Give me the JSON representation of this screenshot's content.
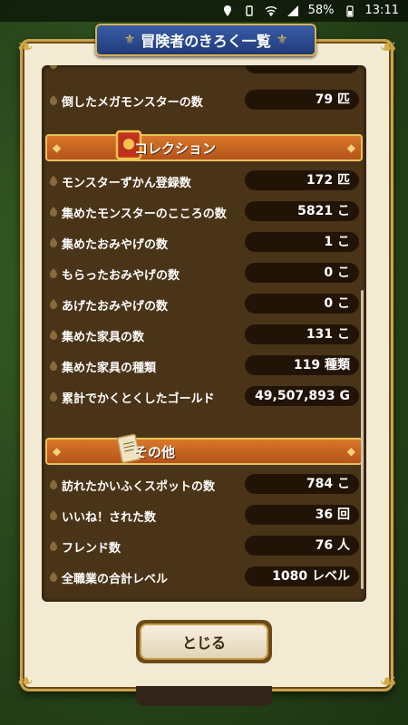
{
  "status_bar": {
    "battery": "58%",
    "time": "13:11"
  },
  "title": "冒険者のきろく一覧",
  "rows_top": [
    {
      "label": "倒したメガモンスターの数",
      "value": "79 匹"
    }
  ],
  "section_collection": {
    "label": "コレクション",
    "rows": [
      {
        "label": "モンスターずかん登録数",
        "value": "172 匹"
      },
      {
        "label": "集めたモンスターのこころの数",
        "value": "5821 こ"
      },
      {
        "label": "集めたおみやげの数",
        "value": "1 こ"
      },
      {
        "label": "もらったおみやげの数",
        "value": "0 こ"
      },
      {
        "label": "あげたおみやげの数",
        "value": "0 こ"
      },
      {
        "label": "集めた家具の数",
        "value": "131 こ"
      },
      {
        "label": "集めた家具の種類",
        "value": "119 種類"
      },
      {
        "label": "累計でかくとくしたゴールド",
        "value": "49,507,893 G"
      }
    ]
  },
  "section_other": {
    "label": "その他",
    "rows": [
      {
        "label": "訪れたかいふくスポットの数",
        "value": "784 こ"
      },
      {
        "label": "いいね！された数",
        "value": "36 回"
      },
      {
        "label": "フレンド数",
        "value": "76 人"
      },
      {
        "label": "全職業の合計レベル",
        "value": "1080 レベル"
      }
    ]
  },
  "close_label": "とじる"
}
